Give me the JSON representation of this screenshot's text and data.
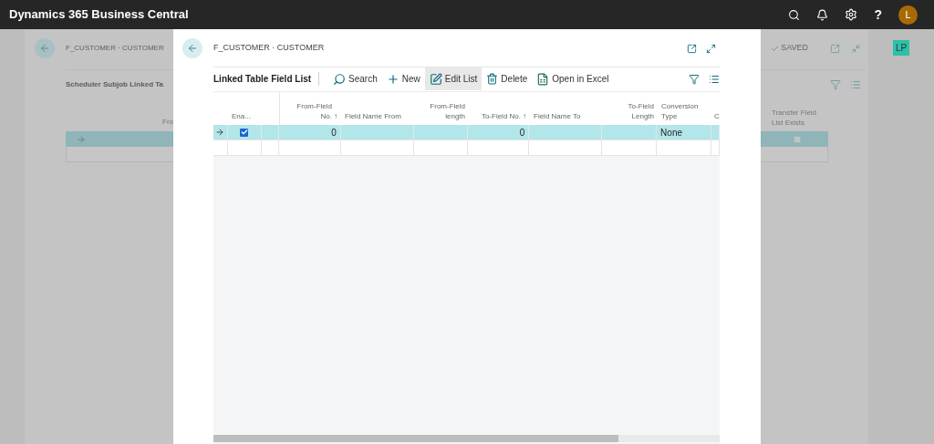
{
  "app_bar": {
    "title": "Dynamics 365 Business Central",
    "help": "?",
    "avatar": "L"
  },
  "background_page": {
    "title": "F_CUSTOMER · CUSTOMER",
    "status": "SAVED",
    "list_title": "Scheduler Subjob Linked Ta",
    "badge": "LP",
    "columns": [
      "Fro",
      "Transfer Field List Exists"
    ],
    "rows": [
      {
        "selected": true,
        "transfer_field_list_exists": false
      }
    ]
  },
  "dialog": {
    "title": "F_CUSTOMER · CUSTOMER",
    "list_title": "Linked Table Field List",
    "actions": [
      {
        "kind": "search",
        "label": "Search",
        "selected": false
      },
      {
        "kind": "new",
        "label": "New",
        "selected": false
      },
      {
        "kind": "edit",
        "label": "Edit List",
        "selected": true
      },
      {
        "kind": "delete",
        "label": "Delete",
        "selected": false
      },
      {
        "kind": "excel",
        "label": "Open in Excel",
        "selected": false
      }
    ],
    "columns": [
      {
        "label": "Ena..."
      },
      {
        "label": "From-Field No.",
        "sort_arrow": "↑"
      },
      {
        "label": "Field Name From"
      },
      {
        "label": "From-Field length"
      },
      {
        "label": "To-Field No.",
        "sort_arrow": "↑"
      },
      {
        "label": "Field Name To"
      },
      {
        "label": "To-Field Length"
      },
      {
        "label": "Conversion Type"
      },
      {
        "label": "C"
      }
    ],
    "rows": [
      {
        "kind": "entry",
        "selected": true,
        "enabled": true,
        "from_field_no": "0",
        "to_field_no": "0",
        "conversion_type": "None"
      },
      {
        "kind": "new",
        "selected": false
      }
    ]
  }
}
